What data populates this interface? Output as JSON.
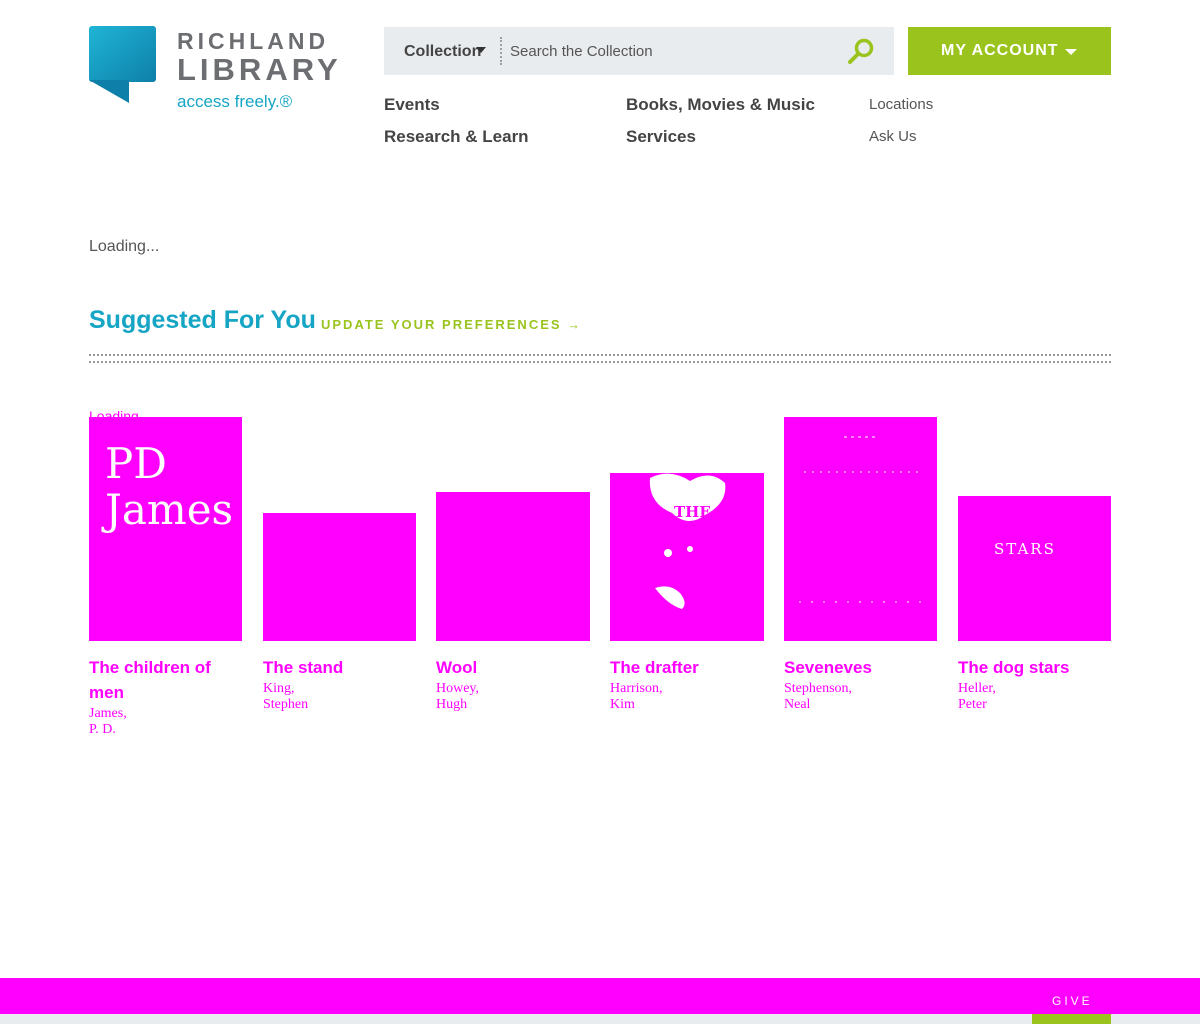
{
  "brand": {
    "name_line1": "RICHLAND",
    "name_line2": "LIBRARY",
    "tagline": "access freely.®",
    "accent_blue": "#16a5c4",
    "accent_green": "#9ac41d",
    "placeholder_magenta": "#ff00ff"
  },
  "search": {
    "scope_label": "Collection",
    "placeholder": "Search the Collection",
    "button_icon": "search-icon"
  },
  "account": {
    "label": "MY ACCOUNT",
    "icon": "caret-down-icon"
  },
  "nav": {
    "events": "Events",
    "books": "Books, Movies & Music",
    "locations": "Locations",
    "research": "Research & Learn",
    "services": "Services",
    "ask": "Ask Us"
  },
  "main": {
    "loading_text": "Loading...",
    "suggested_title": "Suggested For You",
    "update_link": "UPDATE YOUR PREFERENCES →",
    "carousel_loading": "Loading..."
  },
  "books": [
    {
      "title": "The children of men",
      "author": "James, P. D.",
      "cover_text": "PD James"
    },
    {
      "title": "The stand",
      "author": "King, Stephen",
      "cover_text": ""
    },
    {
      "title": "Wool",
      "author": "Howey, Hugh",
      "cover_text": ""
    },
    {
      "title": "The drafter",
      "author": "Harrison, Kim",
      "cover_text": "THE"
    },
    {
      "title": "Seveneves",
      "author": "Stephenson, Neal",
      "cover_text": ""
    },
    {
      "title": "The dog stars",
      "author": "Heller, Peter",
      "cover_text": "STARS"
    }
  ],
  "footer": {
    "give_label": "GIVE"
  }
}
